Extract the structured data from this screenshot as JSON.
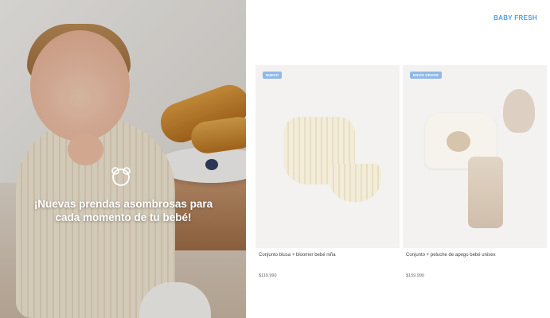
{
  "hero": {
    "headline": "¡Nuevas prendas asombrosas para cada momento de tu bebé!",
    "icon": "bear-face-icon"
  },
  "brand": {
    "name": "BABY FRESH",
    "color": "#4da0e6"
  },
  "products": [
    {
      "tag": "NUEVO",
      "name": "Conjunto blusa + bloomer bebé niña",
      "price": "$119.990"
    },
    {
      "tag": "ENVÍO GRATIS",
      "name": "Conjunto + peluche de apego bebé unisex",
      "price": "$159.990"
    }
  ],
  "colors": {
    "tag_bg": "#8eb9ea",
    "card_bg": "#f3f2f0"
  }
}
